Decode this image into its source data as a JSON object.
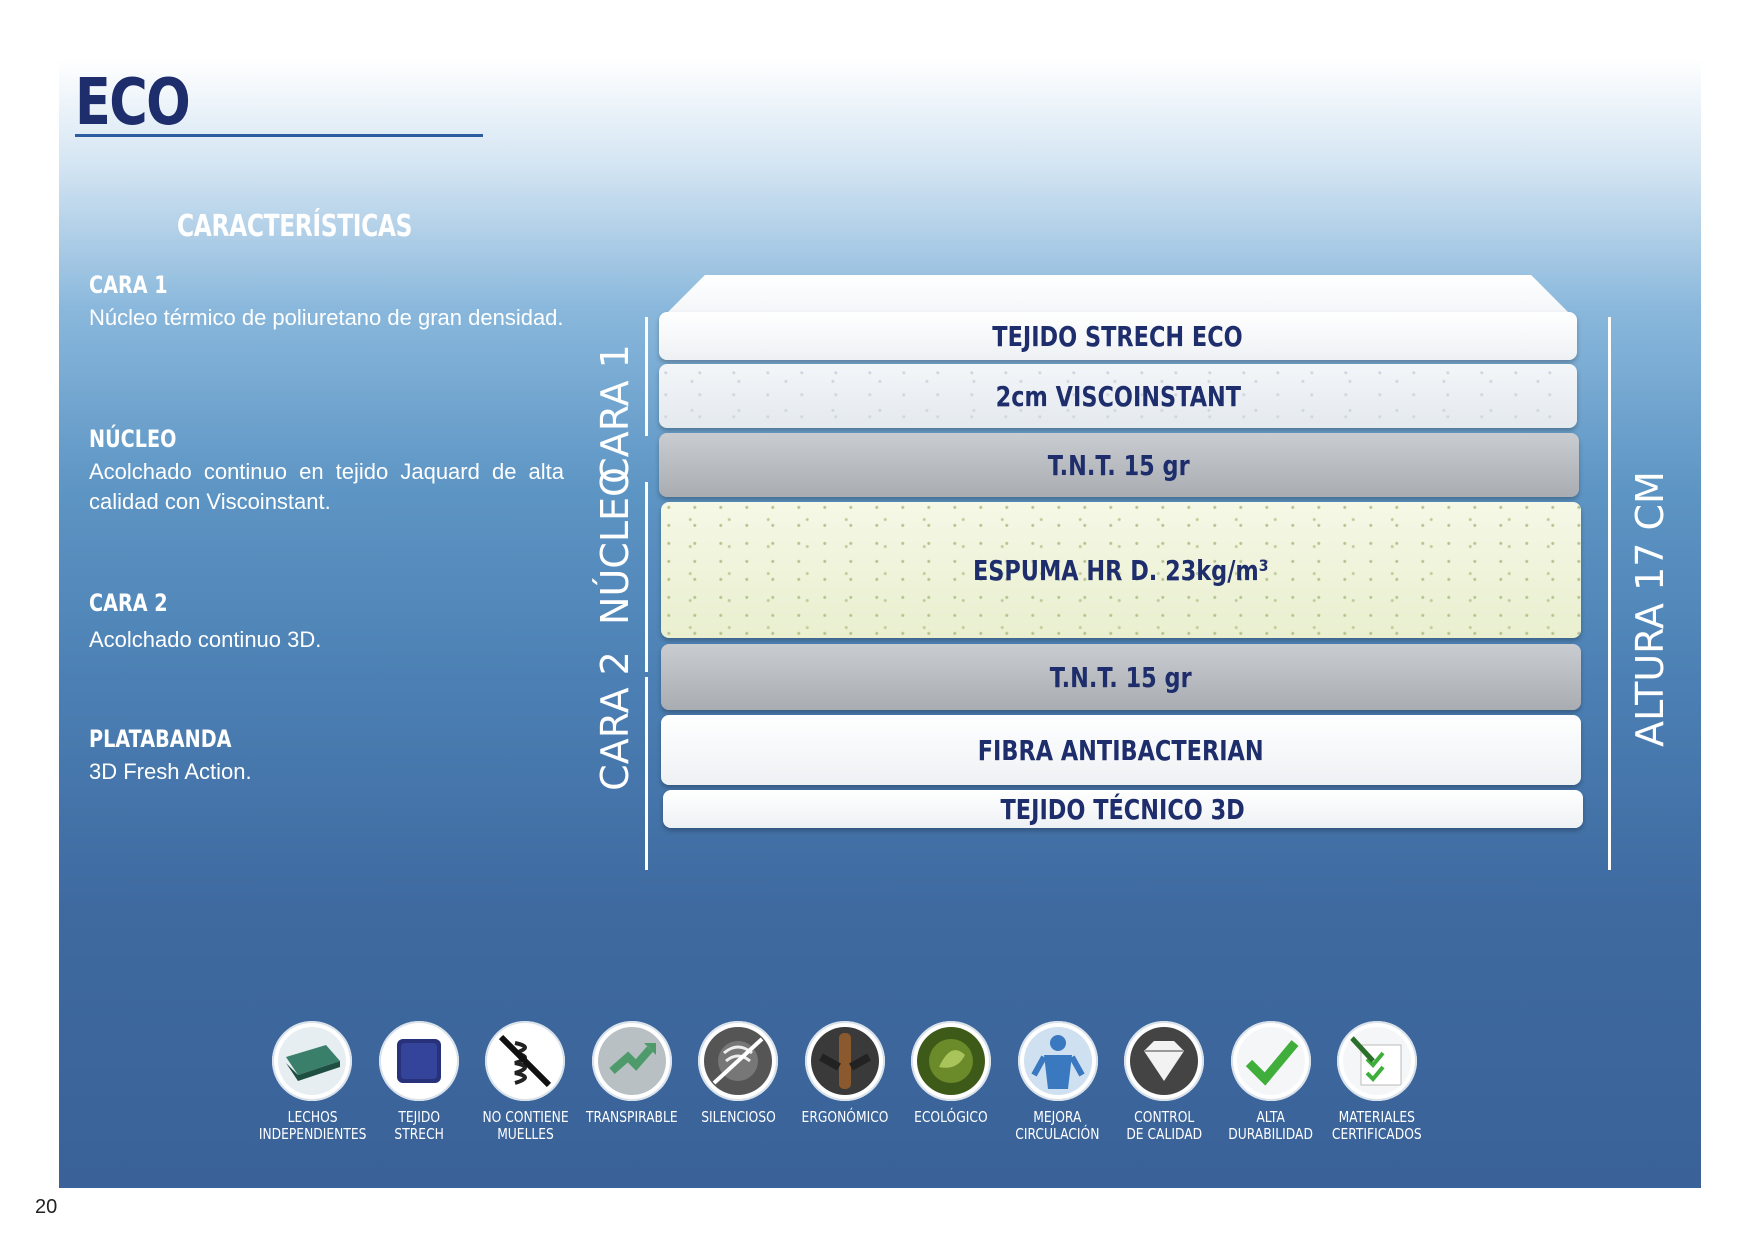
{
  "title": "ECO",
  "characteristics": {
    "heading": "CARACTERÍSTICAS",
    "items": [
      {
        "title": "CARA 1",
        "description": "Núcleo térmico de poliuretano de gran densidad."
      },
      {
        "title": "NÚCLEO",
        "description": "Acolchado continuo en tejido Jaquard de alta calidad con Viscoinstant."
      },
      {
        "title": "CARA 2",
        "description": "Acolchado continuo 3D."
      },
      {
        "title": "PLATABANDA",
        "description": "3D Fresh Action."
      }
    ]
  },
  "side_labels": {
    "cara1": "CARA 1",
    "nucleo": "NÚCLEO",
    "cara2": "CARA 2",
    "altura": "ALTURA 17 CM"
  },
  "layers": [
    {
      "label": "TEJIDO STRECH ECO"
    },
    {
      "label": "2cm VISCOINSTANT"
    },
    {
      "label": "T.N.T. 15 gr"
    },
    {
      "label": "ESPUMA HR D. 23kg/m³"
    },
    {
      "label": "T.N.T. 15 gr"
    },
    {
      "label": "FIBRA ANTIBACTERIAN"
    },
    {
      "label": "TEJIDO TÉCNICO 3D"
    }
  ],
  "icons": [
    {
      "name": "lechos-icon",
      "label": "LECHOS\nINDEPENDIENTES",
      "color": "#3a7f6a"
    },
    {
      "name": "tejido-icon",
      "label": "TEJIDO\nSTRECH",
      "color": "#27327a"
    },
    {
      "name": "no-springs-icon",
      "label": "NO CONTIENE\nMUELLES",
      "color": "#222222"
    },
    {
      "name": "transpirable-icon",
      "label": "TRANSPIRABLE",
      "color": "#4f9a6a"
    },
    {
      "name": "silencioso-icon",
      "label": "SILENCIOSO",
      "color": "#333333"
    },
    {
      "name": "ergonomico-icon",
      "label": "ERGONÓMICO",
      "color": "#5a3a1e"
    },
    {
      "name": "ecologico-icon",
      "label": "ECOLÓGICO",
      "color": "#4d6b1e"
    },
    {
      "name": "circulacion-icon",
      "label": "MEJORA\nCIRCULACIÓN",
      "color": "#3a78c0"
    },
    {
      "name": "control-calidad-icon",
      "label": "CONTROL\nDE CALIDAD",
      "color": "#555555"
    },
    {
      "name": "durabilidad-icon",
      "label": "ALTA\nDURABILIDAD",
      "color": "#3fae3a"
    },
    {
      "name": "certificados-icon",
      "label": "MATERIALES\nCERTIFICADOS",
      "color": "#3fae3a"
    }
  ],
  "page_number": "20"
}
